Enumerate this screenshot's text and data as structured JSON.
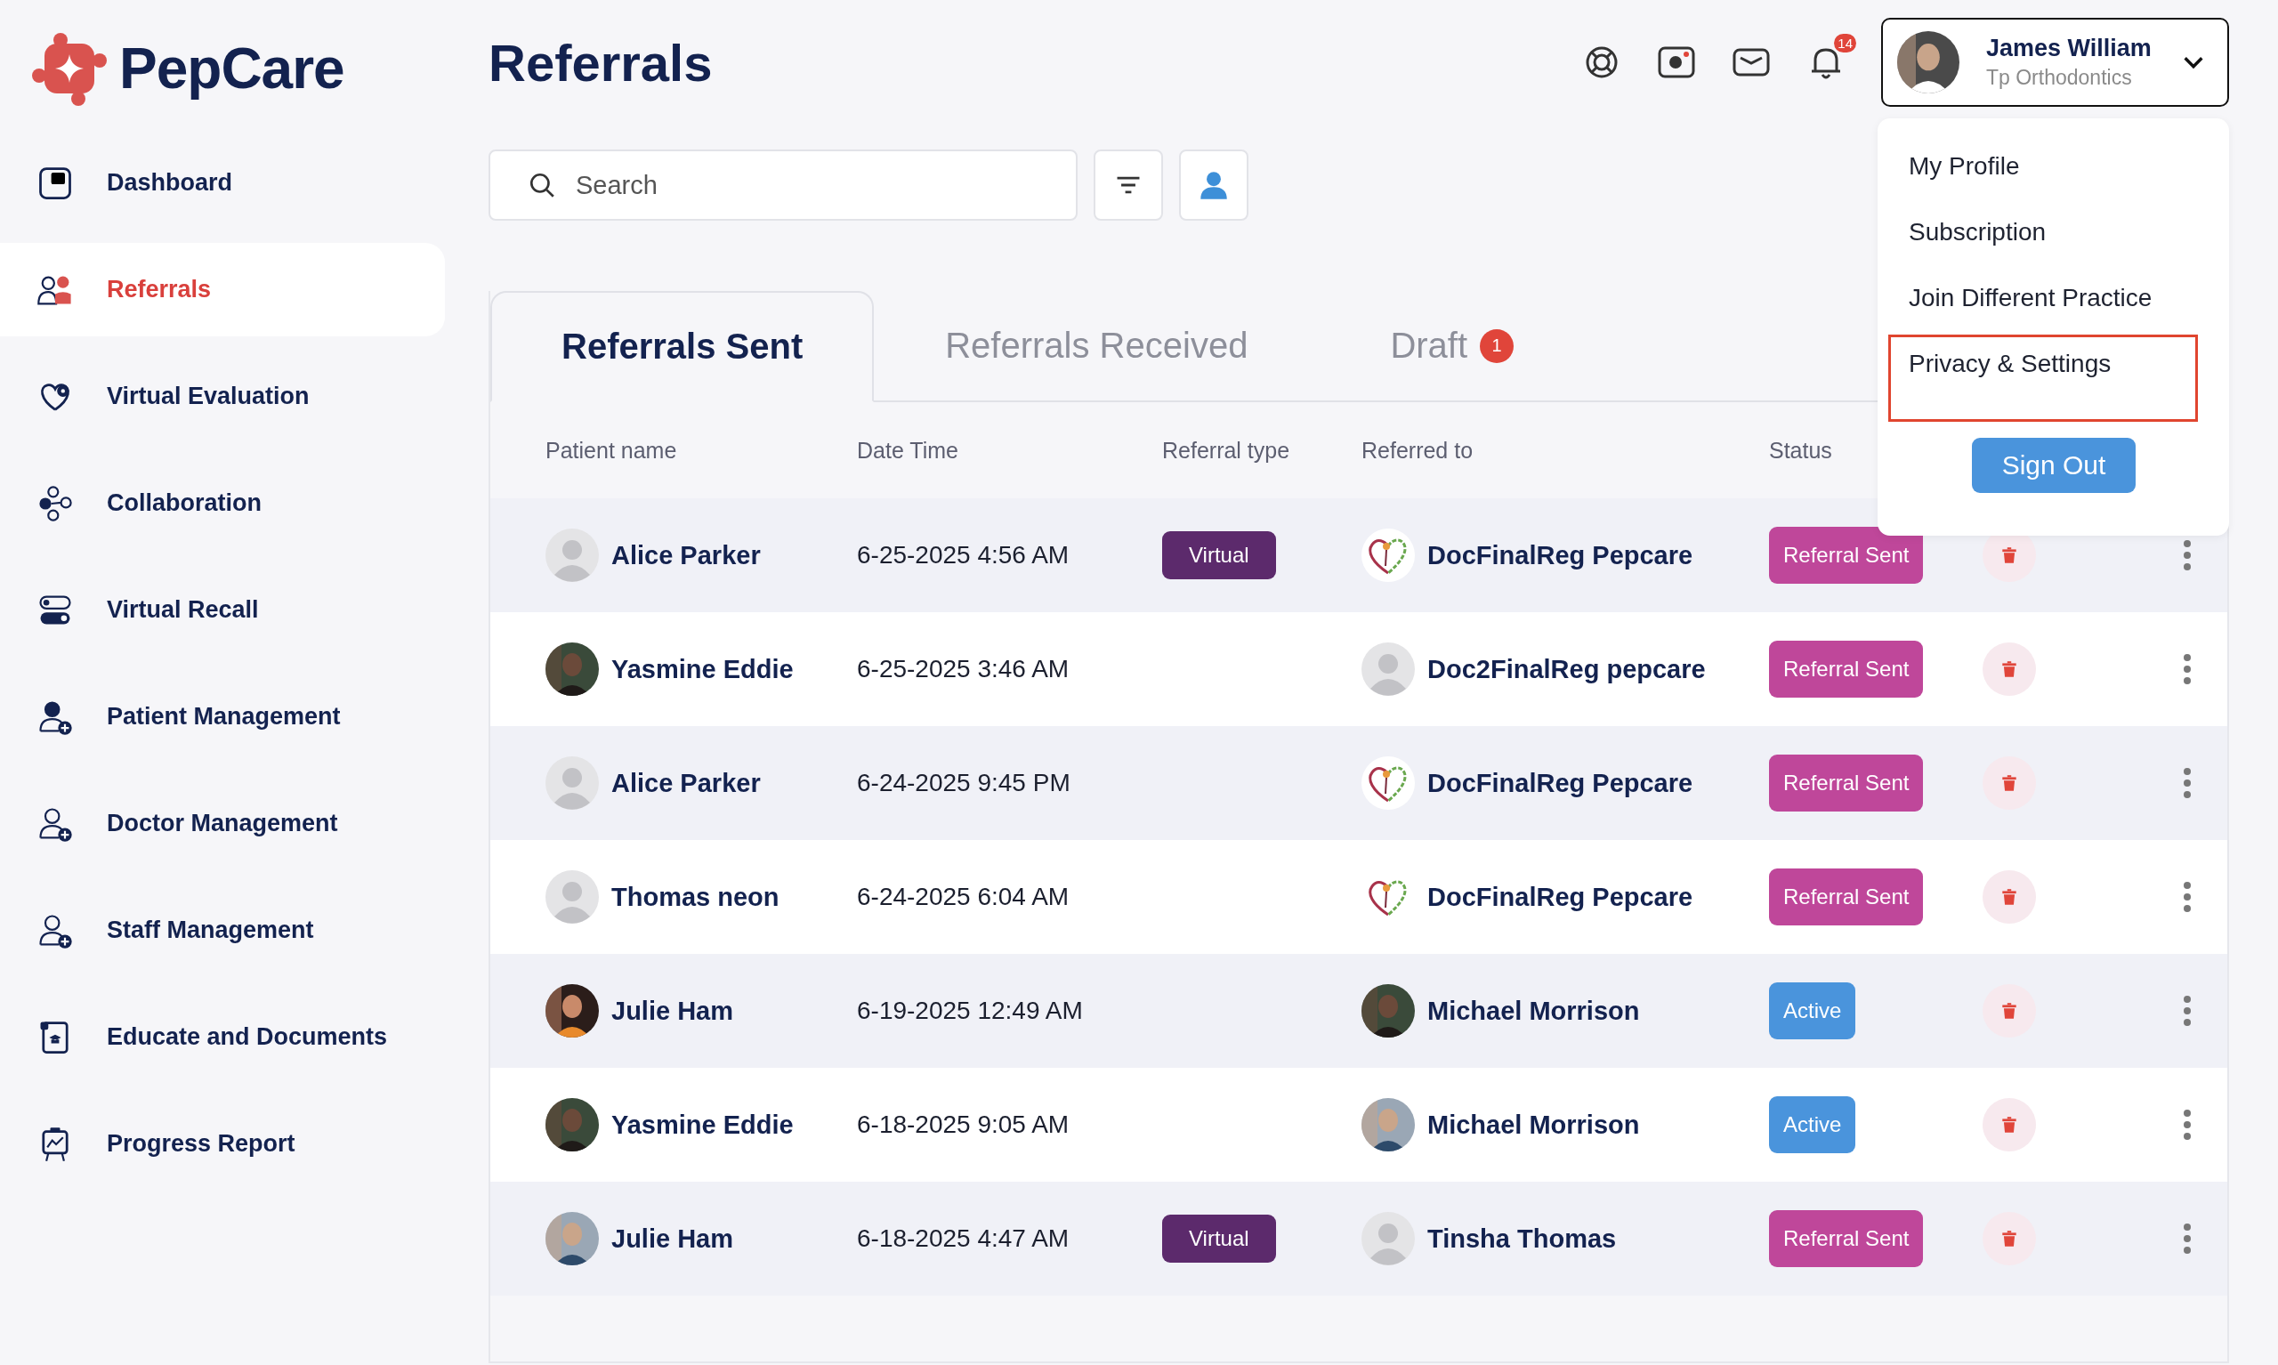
{
  "app": {
    "logo": "PepCare"
  },
  "sidebar": {
    "items": [
      {
        "label": "Dashboard",
        "selected": false
      },
      {
        "label": "Referrals",
        "selected": true
      },
      {
        "label": "Virtual Evaluation",
        "selected": false
      },
      {
        "label": "Collaboration",
        "selected": false
      },
      {
        "label": "Virtual Recall",
        "selected": false
      },
      {
        "label": "Patient Management",
        "selected": false
      },
      {
        "label": "Doctor Management",
        "selected": false
      },
      {
        "label": "Staff Management",
        "selected": false
      },
      {
        "label": "Educate and Documents",
        "selected": false
      },
      {
        "label": "Progress Report",
        "selected": false
      }
    ]
  },
  "page_title": "Referrals",
  "header": {
    "notification_count": "14",
    "user": {
      "name": "James William",
      "practice": "Tp Orthodontics"
    }
  },
  "search": {
    "placeholder": "Search"
  },
  "tabs": [
    {
      "label": "Referrals Sent",
      "selected": true
    },
    {
      "label": "Referrals Received",
      "selected": false
    },
    {
      "label": "Draft",
      "selected": false,
      "badge": "1"
    }
  ],
  "table": {
    "columns": [
      "Patient name",
      "Date Time",
      "Referral type",
      "Referred to",
      "Status"
    ],
    "rows": [
      {
        "patient": {
          "name": "Alice Parker",
          "kind": "generic"
        },
        "date_time": "6-25-2025 4:56 AM",
        "referral_type": "Virtual",
        "referred_to": {
          "name": "DocFinalReg Pepcare",
          "kind": "logo"
        },
        "status": {
          "label": "Referral Sent",
          "color": "#bf479a"
        }
      },
      {
        "patient": {
          "name": "Yasmine Eddie",
          "kind": "picture"
        },
        "date_time": "6-25-2025 3:46 AM",
        "referred_to": {
          "name": "Doc2FinalReg pepcare",
          "kind": "generic"
        },
        "status": {
          "label": "Referral Sent",
          "color": "#bf479a"
        }
      },
      {
        "patient": {
          "name": "Alice Parker",
          "kind": "generic"
        },
        "date_time": "6-24-2025 9:45 PM",
        "referred_to": {
          "name": "DocFinalReg Pepcare",
          "kind": "logo"
        },
        "status": {
          "label": "Referral Sent",
          "color": "#bf479a"
        }
      },
      {
        "patient": {
          "name": "Thomas neon",
          "kind": "generic"
        },
        "date_time": "6-24-2025 6:04 AM",
        "referred_to": {
          "name": "DocFinalReg Pepcare",
          "kind": "logo"
        },
        "status": {
          "label": "Referral Sent",
          "color": "#bf479a"
        }
      },
      {
        "patient": {
          "name": "Julie Ham",
          "kind": "picture"
        },
        "date_time": "6-19-2025 12:49 AM",
        "referred_to": {
          "name": "Michael Morrison",
          "kind": "picture"
        },
        "status": {
          "label": "Active",
          "color": "#4a94dc"
        }
      },
      {
        "patient": {
          "name": "Yasmine Eddie",
          "kind": "picture"
        },
        "date_time": "6-18-2025 9:05 AM",
        "referred_to": {
          "name": "Michael Morrison",
          "kind": "picture"
        },
        "status": {
          "label": "Active",
          "color": "#4a94dc"
        }
      },
      {
        "patient": {
          "name": "Julie Ham",
          "kind": "picture"
        },
        "date_time": "6-18-2025 4:47 AM",
        "referral_type": "Virtual",
        "referred_to": {
          "name": "Tinsha Thomas",
          "kind": "generic"
        },
        "status": {
          "label": "Referral Sent",
          "color": "#bf479a"
        }
      }
    ]
  },
  "user_menu": {
    "items": [
      {
        "label": "My Profile",
        "highlighted": false
      },
      {
        "label": "Subscription",
        "highlighted": false
      },
      {
        "label": "Join Different Practice",
        "highlighted": false
      },
      {
        "label": "Privacy & Settings",
        "highlighted": true
      }
    ],
    "sign_out": "Sign Out"
  }
}
